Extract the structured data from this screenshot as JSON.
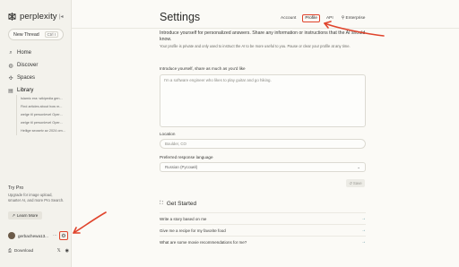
{
  "brand": {
    "name": "perplexity",
    "collapse_icon": "sidebar-collapse-icon"
  },
  "sidebar": {
    "new_thread_label": "New Thread",
    "new_thread_shortcut": "Ctrl I",
    "nav": [
      {
        "label": "Home",
        "icon": "search-icon"
      },
      {
        "label": "Discover",
        "icon": "globe-icon"
      },
      {
        "label": "Spaces",
        "icon": "grid-icon"
      },
      {
        "label": "Library",
        "icon": "library-icon"
      }
    ],
    "library_items": [
      "Islamic era: wikipedia gen...",
      "Find articles about how m...",
      "welge til personlevel Oper...",
      "welge til personlevel Oper...",
      "Hellige seosetv av 2024 om..."
    ],
    "try_pro_title": "Try Pro",
    "try_pro_desc": "Upgrade for image upload, smarter AI, and more Pro Search.",
    "learn_more_label": "Learn More",
    "username": "gerbachewa13...",
    "download_label": "Download",
    "social_x": "𝕏",
    "social_discord": "◉"
  },
  "header": {
    "title": "Settings",
    "tabs": [
      {
        "label": "Account",
        "active": false
      },
      {
        "label": "Profile",
        "active": true
      },
      {
        "label": "API",
        "active": false
      },
      {
        "label": "⚲ Enterprise",
        "active": false
      }
    ]
  },
  "profile": {
    "intro_main": "Introduce yourself for personalized answers. Share any information or instructions that the AI should know.",
    "intro_sub": "Your profile is private and only used to instruct the AI to be more useful to you. Pause or clear your profile at any time.",
    "introduce_label": "Introduce yourself, share as much as you'd like",
    "introduce_placeholder": "I'm a software engineer who likes to play guitar and go hiking.",
    "location_label": "Location",
    "location_placeholder": "Boulder, CO",
    "language_label": "Preferred response language",
    "language_value": "Russian (Русский)",
    "save_label": "Save"
  },
  "get_started": {
    "title": "Get Started",
    "items": [
      "Write a story based on me",
      "Give me a recipe for my favorite food",
      "What are some movie recommendations for me?"
    ]
  },
  "colors": {
    "accent_annotation": "#e0442c",
    "link_arrow": "#3a7f8e",
    "sidebar_bg": "#f3f2ec"
  }
}
